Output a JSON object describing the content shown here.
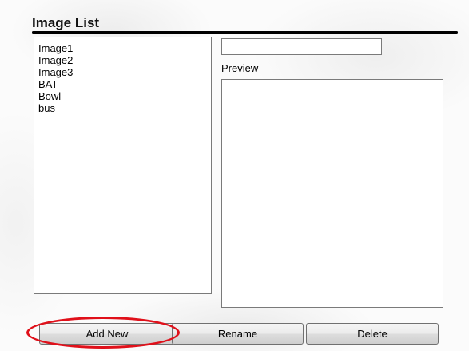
{
  "window": {
    "title": "Image List"
  },
  "image_list": {
    "items": [
      "Image1",
      "Image2",
      "Image3",
      "BAT",
      "Bowl",
      "bus"
    ]
  },
  "name_field": {
    "value": "",
    "placeholder": ""
  },
  "preview": {
    "label": "Preview"
  },
  "buttons": {
    "add_new": "Add New",
    "rename": "Rename",
    "delete": "Delete"
  },
  "annotation": {
    "highlight_color": "#e0101a",
    "highlighted_target": "add-new-button"
  }
}
